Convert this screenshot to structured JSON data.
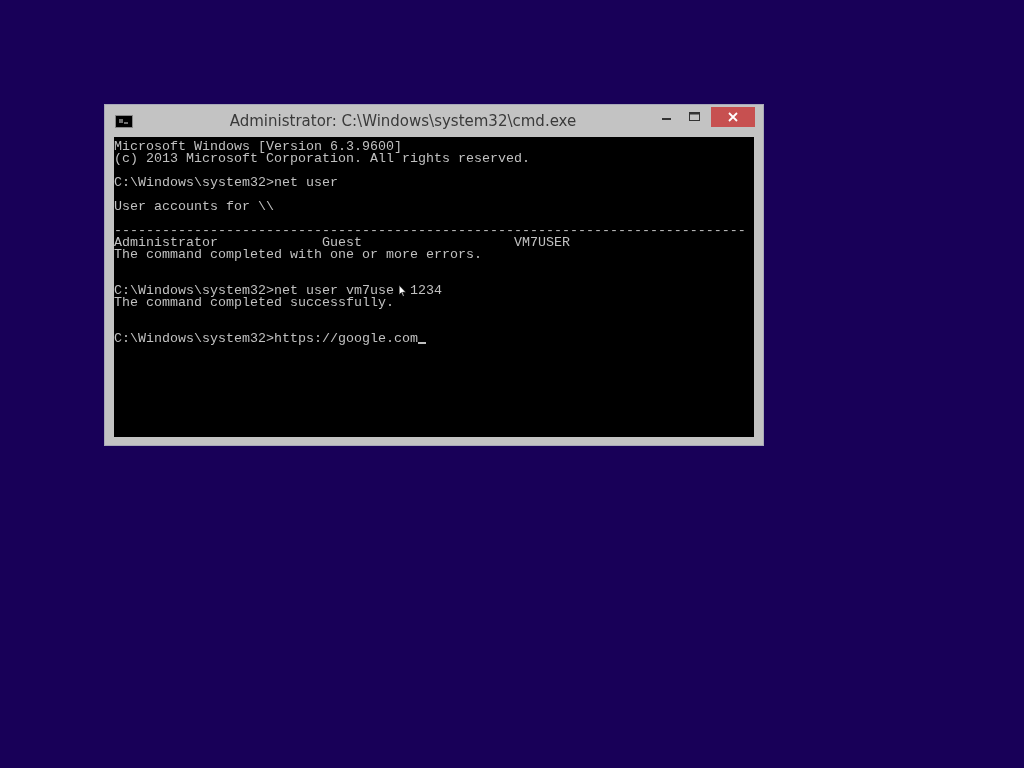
{
  "window": {
    "title": "Administrator: C:\\Windows\\system32\\cmd.exe"
  },
  "console": {
    "lines": [
      {
        "kind": "text",
        "text": "Microsoft Windows [Version 6.3.9600]"
      },
      {
        "kind": "text",
        "text": "(c) 2013 Microsoft Corporation. All rights reserved."
      },
      {
        "kind": "blank"
      },
      {
        "kind": "text",
        "text": "C:\\Windows\\system32>net user"
      },
      {
        "kind": "blank"
      },
      {
        "kind": "text",
        "text": "User accounts for \\\\"
      },
      {
        "kind": "blank"
      },
      {
        "kind": "text",
        "text": "-------------------------------------------------------------------------------"
      },
      {
        "kind": "columns",
        "cells": [
          "Administrator",
          "Guest",
          "VM7USER"
        ]
      },
      {
        "kind": "text",
        "text": "The command completed with one or more errors."
      },
      {
        "kind": "blank"
      },
      {
        "kind": "blank"
      },
      {
        "kind": "pointer",
        "text": "C:\\Windows\\system32>net user vm7use",
        "after": "1234"
      },
      {
        "kind": "text",
        "text": "The command completed successfully."
      },
      {
        "kind": "blank"
      },
      {
        "kind": "blank"
      },
      {
        "kind": "text",
        "text": "C:\\Windows\\system32>https://google.com",
        "cursor": true
      }
    ]
  }
}
